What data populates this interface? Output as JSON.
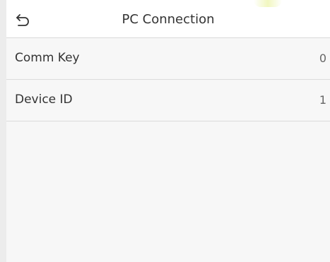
{
  "header": {
    "title": "PC Connection",
    "back_icon": "back-arrow-icon"
  },
  "settings": {
    "items": [
      {
        "label": "Comm Key",
        "value": "0"
      },
      {
        "label": "Device ID",
        "value": "1"
      }
    ]
  },
  "colors": {
    "background": "#f7f7f7",
    "header_background": "#ffffff",
    "divider": "#dcdcdc",
    "text": "#333333",
    "value_text": "#666666"
  }
}
